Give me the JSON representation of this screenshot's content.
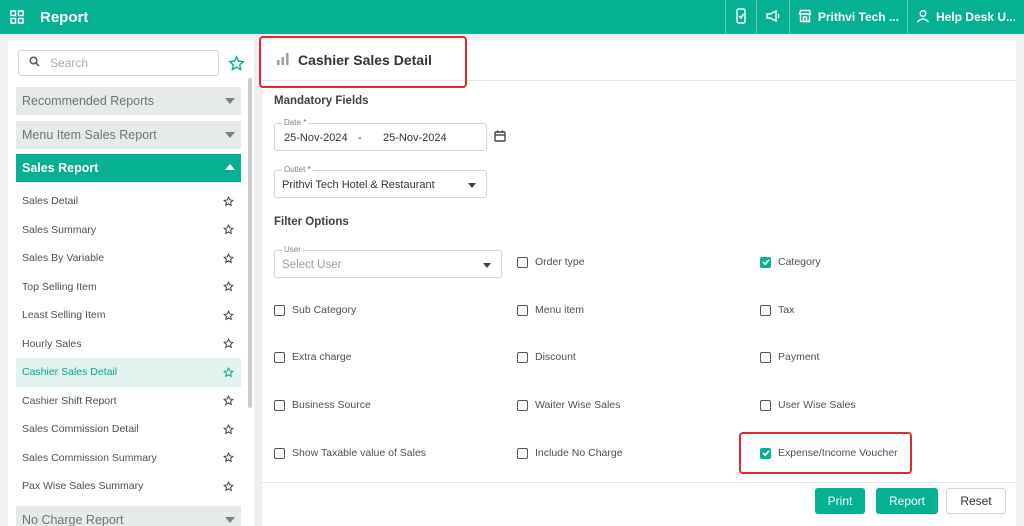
{
  "app": {
    "title": "Report"
  },
  "topbar": {
    "outlet_label": "Prithvi Tech ...",
    "user_label": "Help Desk U..."
  },
  "sidebar": {
    "search_placeholder": "Search",
    "sections": {
      "recommended": "Recommended Reports",
      "menu_item_sales": "Menu Item Sales Report",
      "sales_report": "Sales Report",
      "no_charge": "No Charge Report"
    },
    "items": [
      {
        "label": "Sales Detail"
      },
      {
        "label": "Sales Summary"
      },
      {
        "label": "Sales By Variable"
      },
      {
        "label": "Top Selling Item"
      },
      {
        "label": "Least Selling Item"
      },
      {
        "label": "Hourly Sales"
      },
      {
        "label": "Cashier Sales Detail"
      },
      {
        "label": "Cashier Shift Report"
      },
      {
        "label": "Sales Commission Detail"
      },
      {
        "label": "Sales Commission Summary"
      },
      {
        "label": "Pax Wise Sales Summary"
      }
    ]
  },
  "main": {
    "title": "Cashier Sales Detail",
    "mandatory_label": "Mandatory Fields",
    "date": {
      "label": "Date",
      "from": "25-Nov-2024",
      "separator": "-",
      "to": "25-Nov-2024"
    },
    "outlet": {
      "label": "Outlet",
      "value": "Prithvi Tech Hotel & Restaurant"
    },
    "filter_label": "Filter Options",
    "user": {
      "label": "User",
      "placeholder": "Select User"
    },
    "filters": {
      "order_type": {
        "label": "Order type",
        "checked": false
      },
      "category": {
        "label": "Category",
        "checked": true
      },
      "sub_category": {
        "label": "Sub Category",
        "checked": false
      },
      "menu_item": {
        "label": "Menu item",
        "checked": false
      },
      "tax": {
        "label": "Tax",
        "checked": false
      },
      "extra_charge": {
        "label": "Extra charge",
        "checked": false
      },
      "discount": {
        "label": "Discount",
        "checked": false
      },
      "payment": {
        "label": "Payment",
        "checked": false
      },
      "business_source": {
        "label": "Business Source",
        "checked": false
      },
      "waiter_wise_sales": {
        "label": "Waiter Wise Sales",
        "checked": false
      },
      "user_wise_sales": {
        "label": "User Wise Sales",
        "checked": false
      },
      "show_taxable": {
        "label": "Show Taxable value of Sales",
        "checked": false
      },
      "include_no_charge": {
        "label": "Include No Charge",
        "checked": false
      },
      "expense_income": {
        "label": "Expense/Income Voucher",
        "checked": true
      }
    },
    "buttons": {
      "print": "Print",
      "report": "Report",
      "reset": "Reset"
    }
  },
  "colors": {
    "accent": "#06b193",
    "highlight": "#e02a2a"
  }
}
